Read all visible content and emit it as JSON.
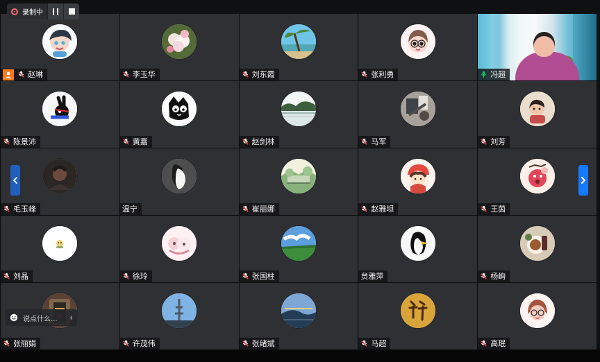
{
  "recording": {
    "status_label": "录制中",
    "pause_icon": "pause-icon",
    "stop_icon": "stop-icon"
  },
  "chat": {
    "placeholder": "说点什么...",
    "expand_icon": "chevron-left-icon"
  },
  "navigation": {
    "previous_icon": "chevron-left-icon",
    "next_icon": "chevron-right-icon"
  },
  "colors": {
    "tile_background": "#2e3034",
    "host_badge": "#f57c1f",
    "muted_mic": "#e54848",
    "active_mic": "#18b95a",
    "left_arrow": "#225fbd",
    "right_arrow": "#1677ff"
  },
  "participants": [
    {
      "name": "赵琳",
      "avatar_icon": "cartoon-boy-avatar-icon",
      "mic": "muted",
      "host": true
    },
    {
      "name": "李玉华",
      "avatar_icon": "flowers-avatar-icon",
      "mic": "muted",
      "host": false
    },
    {
      "name": "刘东霞",
      "avatar_icon": "beach-palm-avatar-icon",
      "mic": "muted",
      "host": false
    },
    {
      "name": "张利勇",
      "avatar_icon": "cartoon-girl-avatar-icon",
      "mic": "muted",
      "host": false
    },
    {
      "name": "冯超",
      "avatar_icon": "camera-video-icon",
      "mic": "active",
      "host": false
    },
    {
      "name": "陈景沛",
      "avatar_icon": "rabbit-cartoon-avatar-icon",
      "mic": "muted",
      "host": false
    },
    {
      "name": "黄嘉",
      "avatar_icon": "black-cat-avatar-icon",
      "mic": "muted",
      "host": false
    },
    {
      "name": "赵剑林",
      "avatar_icon": "lake-trees-avatar-icon",
      "mic": "muted",
      "host": false
    },
    {
      "name": "马军",
      "avatar_icon": "wall-mural-avatar-icon",
      "mic": "muted",
      "host": false
    },
    {
      "name": "刘芳",
      "avatar_icon": "child-avatar-icon",
      "mic": "muted",
      "host": false
    },
    {
      "name": "毛玉峰",
      "avatar_icon": "man-portrait-avatar-icon",
      "mic": "muted",
      "host": false
    },
    {
      "name": "温宁",
      "avatar_icon": "penguin-avatar-icon",
      "mic": "none",
      "host": false
    },
    {
      "name": "崔丽娜",
      "avatar_icon": "landscape-avatar-icon",
      "mic": "muted",
      "host": false
    },
    {
      "name": "赵雅坦",
      "avatar_icon": "red-hat-girl-avatar-icon",
      "mic": "muted",
      "host": false
    },
    {
      "name": "王茵",
      "avatar_icon": "red-character-avatar-icon",
      "mic": "muted",
      "host": false
    },
    {
      "name": "刘晶",
      "avatar_icon": "small-toy-avatar-icon",
      "mic": "muted",
      "host": false
    },
    {
      "name": "徐玲",
      "avatar_icon": "pink-cartoon-avatar-icon",
      "mic": "muted",
      "host": false
    },
    {
      "name": "张国柱",
      "avatar_icon": "sky-field-avatar-icon",
      "mic": "muted",
      "host": false
    },
    {
      "name": "贠雅萍",
      "avatar_icon": "penguin-cartoon-avatar-icon",
      "mic": "none",
      "host": false
    },
    {
      "name": "杨峋",
      "avatar_icon": "food-plate-avatar-icon",
      "mic": "muted",
      "host": false
    },
    {
      "name": "张丽娟",
      "avatar_icon": "doorway-avatar-icon",
      "mic": "muted",
      "host": false
    },
    {
      "name": "许茂伟",
      "avatar_icon": "tower-sky-avatar-icon",
      "mic": "muted",
      "host": false
    },
    {
      "name": "张绪斌",
      "avatar_icon": "sunset-avatar-icon",
      "mic": "muted",
      "host": false
    },
    {
      "name": "马超",
      "avatar_icon": "calligraphy-avatar-icon",
      "mic": "muted",
      "host": false
    },
    {
      "name": "高珉",
      "avatar_icon": "glasses-girl-avatar-icon",
      "mic": "muted",
      "host": false
    }
  ]
}
